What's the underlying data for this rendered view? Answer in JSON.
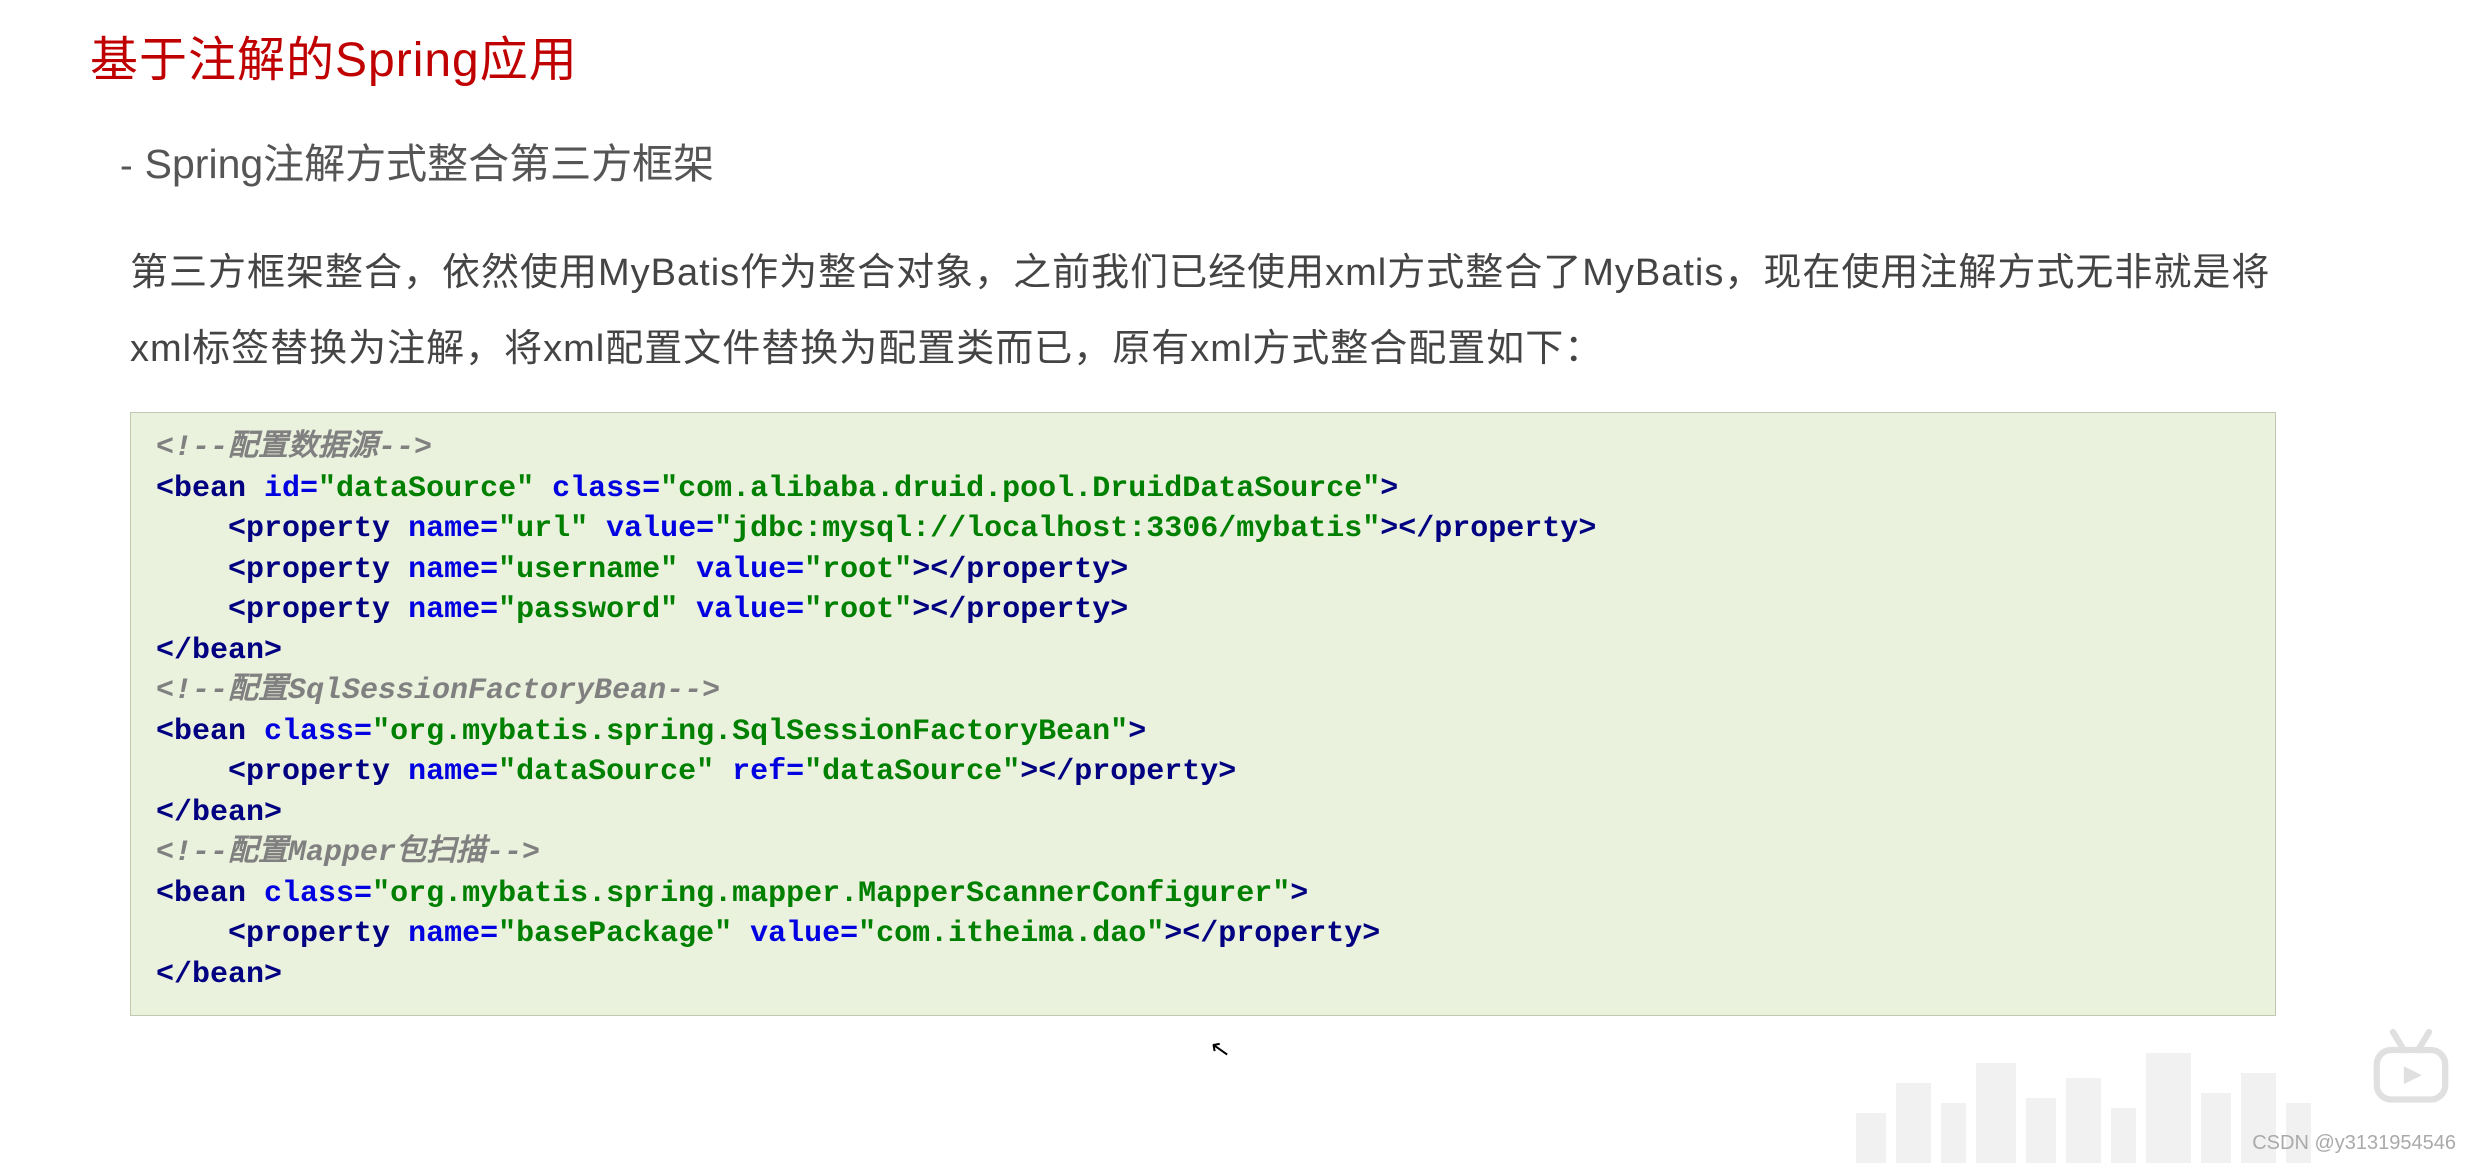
{
  "title": "基于注解的Spring应用",
  "bullet": "-",
  "subtitle": "Spring注解方式整合第三方框架",
  "paragraph": "第三方框架整合，依然使用MyBatis作为整合对象，之前我们已经使用xml方式整合了MyBatis，现在使用注解方式无非就是将xml标签替换为注解，将xml配置文件替换为配置类而已，原有xml方式整合配置如下：",
  "code": {
    "c1": "<!--配置数据源-->",
    "l2_open": "<",
    "l2_tag": "bean",
    "l2_a1n": " id=",
    "l2_a1v": "\"dataSource\"",
    "l2_a2n": " class=",
    "l2_a2v": "\"com.alibaba.druid.pool.DruidDataSource\"",
    "l2_close": ">",
    "l3_indent": "    ",
    "l3_open": "<",
    "l3_tag": "property",
    "l3_a1n": " name=",
    "l3_a1v": "\"url\"",
    "l3_a2n": " value=",
    "l3_a2v": "\"jdbc:mysql://localhost:3306/mybatis\"",
    "l3_close": ">",
    "l3_end_open": "</",
    "l3_end_tag": "property",
    "l3_end_close": ">",
    "l4_a1v": "\"username\"",
    "l4_a2v": "\"root\"",
    "l5_a1v": "\"password\"",
    "l5_a2v": "\"root\"",
    "l6_open": "</",
    "l6_tag": "bean",
    "l6_close": ">",
    "c2": "<!--配置SqlSessionFactoryBean-->",
    "l8_a1n": " class=",
    "l8_a1v": "\"org.mybatis.spring.SqlSessionFactoryBean\"",
    "l9_a1v": "\"dataSource\"",
    "l9_a2n": " ref=",
    "l9_a2v": "\"dataSource\"",
    "c3": "<!--配置Mapper包扫描-->",
    "l12_a1v": "\"org.mybatis.spring.mapper.MapperScannerConfigurer\"",
    "l13_a1v": "\"basePackage\"",
    "l13_a2v": "\"com.itheima.dao\""
  },
  "watermark": "CSDN @y3131954546"
}
